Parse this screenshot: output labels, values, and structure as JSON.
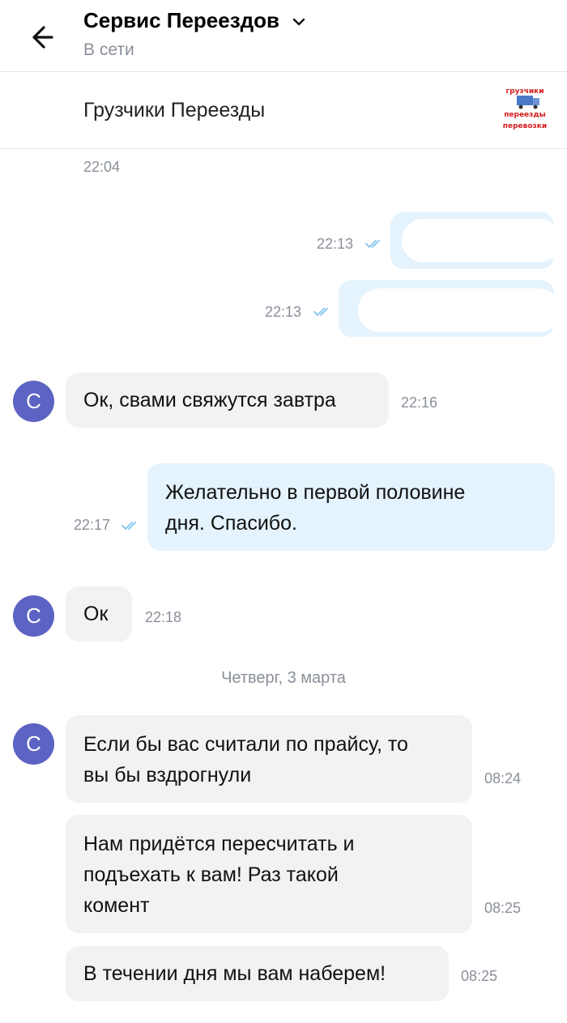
{
  "header": {
    "title": "Сервис Переездов",
    "status": "В сети"
  },
  "group": {
    "name": "Грузчики Переезды",
    "logo_lines": [
      "грузчики",
      "переезды",
      "перевозки"
    ]
  },
  "messages": {
    "top_time": "22:04",
    "hidden_out_1_time": "22:13",
    "hidden_out_2_time": "22:13",
    "m1": {
      "text": "Ок, свами свяжутся завтра",
      "time": "22:16",
      "avatar": "С"
    },
    "m2": {
      "line1": "Желательно в первой половине",
      "line2": "дня. Спасибо.",
      "time": "22:17"
    },
    "m3": {
      "text": "Ок",
      "time": "22:18",
      "avatar": "С"
    },
    "day_separator": "Четверг, 3 марта",
    "m4": {
      "line1": "Если бы вас считали по прайсу, то",
      "line2": "вы бы вздрогнули",
      "time": "08:24",
      "avatar": "С"
    },
    "m5": {
      "line1": "Нам придётся пересчитать и",
      "line2": "подъехать к вам! Раз такой",
      "line3": "комент",
      "time": "08:25"
    },
    "m6": {
      "text": "В течении дня мы вам наберем!",
      "time": "08:25"
    }
  },
  "colors": {
    "avatar": "#5c63c2",
    "incoming_bubble": "#f2f2f3",
    "outgoing_bubble": "#e4f3fd",
    "read_check": "#7fc4ee"
  }
}
